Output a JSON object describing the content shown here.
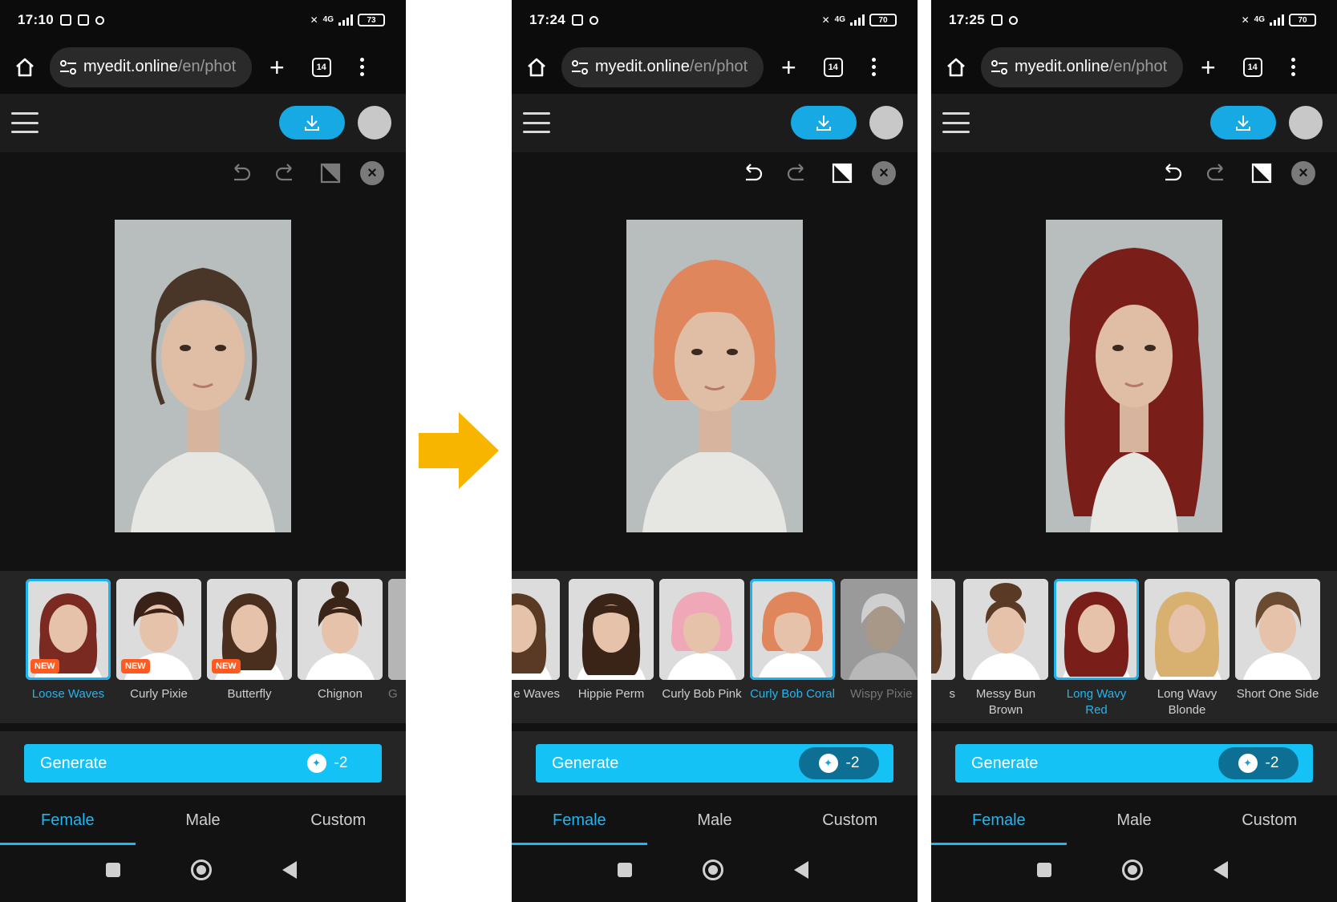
{
  "colors": {
    "accent": "#15c2f5",
    "selected_text": "#22b6f0",
    "new_badge": "#ff5a1f",
    "arrow": "#f7b500"
  },
  "icons": [
    "home-icon",
    "tune-icon",
    "plus-icon",
    "tabs-icon",
    "kebab-icon",
    "hamburger-icon",
    "download-icon",
    "undo-icon",
    "redo-icon",
    "compare-icon",
    "close-icon",
    "credit-icon",
    "square-icon",
    "circle-icon",
    "back-icon",
    "arrow-icon"
  ],
  "phones": [
    {
      "status": {
        "time": "17:10",
        "net": "4G",
        "battery": "73"
      },
      "browser": {
        "domain": "myedit.online",
        "path": "/en/phot",
        "tabs": "14"
      },
      "thumbs": [
        {
          "label": "Loose Waves",
          "badge": "NEW",
          "selected": true
        },
        {
          "label": "Curly Pixie",
          "badge": "NEW"
        },
        {
          "label": "Butterfly",
          "badge": "NEW"
        },
        {
          "label": "Chignon"
        },
        {
          "label": "G"
        }
      ],
      "generate": {
        "label": "Generate",
        "cost": "-2"
      },
      "tabs": [
        {
          "label": "Female",
          "active": true
        },
        {
          "label": "Male"
        },
        {
          "label": "Custom"
        }
      ]
    },
    {
      "status": {
        "time": "17:24",
        "net": "4G",
        "battery": "70"
      },
      "browser": {
        "domain": "myedit.online",
        "path": "/en/phot",
        "tabs": "14"
      },
      "thumbs": [
        {
          "label": "e Waves"
        },
        {
          "label": "Hippie Perm"
        },
        {
          "label": "Curly Bob Pink"
        },
        {
          "label": "Curly Bob Coral",
          "selected": true
        },
        {
          "label": "Wispy Pixie"
        }
      ],
      "generate": {
        "label": "Generate",
        "cost": "-2"
      },
      "tabs": [
        {
          "label": "Female",
          "active": true
        },
        {
          "label": "Male"
        },
        {
          "label": "Custom"
        }
      ]
    },
    {
      "status": {
        "time": "17:25",
        "net": "4G",
        "battery": "70"
      },
      "browser": {
        "domain": "myedit.online",
        "path": "/en/phot",
        "tabs": "14"
      },
      "thumbs": [
        {
          "label": "s"
        },
        {
          "label": "Messy Bun Brown"
        },
        {
          "label": "Long Wavy Red",
          "selected": true
        },
        {
          "label": "Long Wavy Blonde"
        },
        {
          "label": "Short One Side"
        }
      ],
      "generate": {
        "label": "Generate",
        "cost": "-2"
      },
      "tabs": [
        {
          "label": "Female",
          "active": true
        },
        {
          "label": "Male"
        },
        {
          "label": "Custom"
        }
      ]
    }
  ]
}
